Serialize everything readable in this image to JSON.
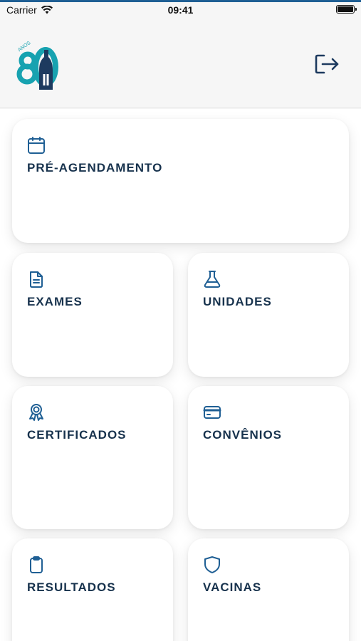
{
  "status_bar": {
    "carrier": "Carrier",
    "time": "09:41"
  },
  "header": {
    "logo_text": "ANOS",
    "logo_number": "80",
    "logout_icon": "logout-icon"
  },
  "colors": {
    "accent": "#1f5f94",
    "label": "#17324d",
    "logo_teal": "#17a2b0",
    "logo_dark": "#1d3a5f"
  },
  "menu": {
    "pre_agendamento": {
      "label": "PRÉ-AGENDAMENTO",
      "icon": "calendar-icon"
    },
    "exames": {
      "label": "EXAMES",
      "icon": "document-icon"
    },
    "unidades": {
      "label": "UNIDADES",
      "icon": "flask-icon"
    },
    "certificados": {
      "label": "CERTIFICADOS",
      "icon": "award-icon"
    },
    "convenios": {
      "label": "CONVÊNIOS",
      "icon": "credit-card-icon"
    },
    "resultados": {
      "label": "RESULTADOS",
      "icon": "clipboard-icon"
    },
    "vacinas": {
      "label": "VACINAS",
      "icon": "shield-icon"
    }
  }
}
